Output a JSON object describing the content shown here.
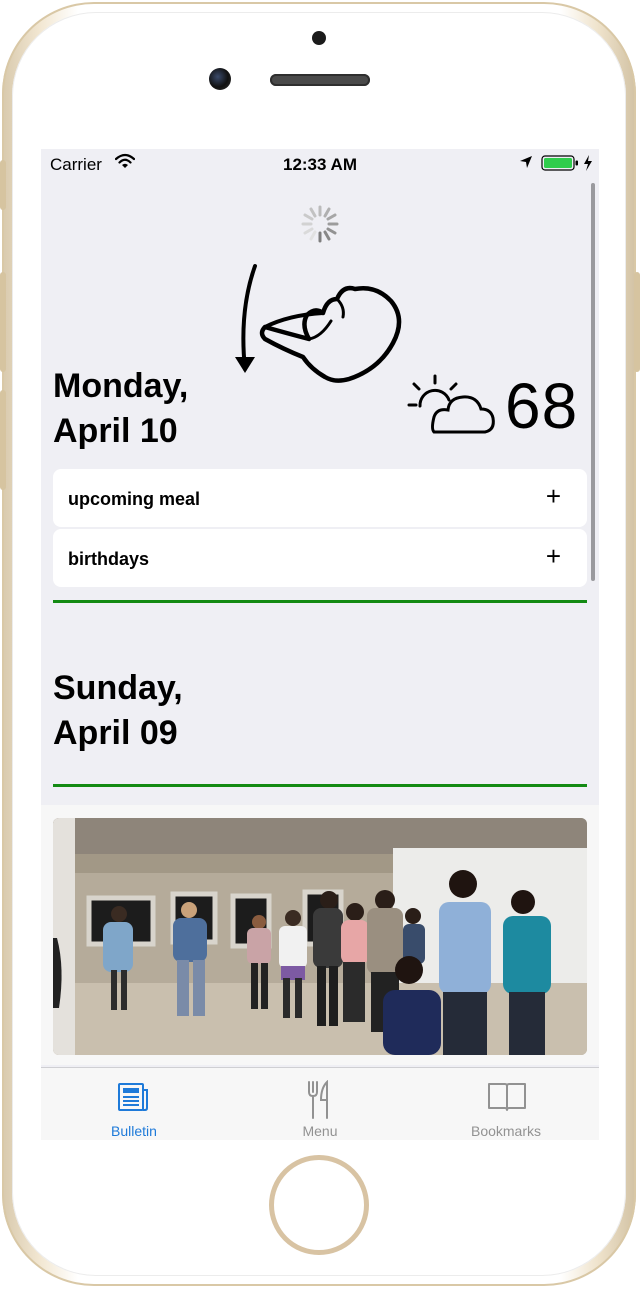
{
  "status_bar": {
    "carrier": "Carrier",
    "time": "12:33 AM"
  },
  "today": {
    "day": "Monday,",
    "date": "April 10",
    "temperature": "68",
    "weather_icon": "partly-sunny-icon"
  },
  "cards": [
    {
      "label": "upcoming meal",
      "action": "+"
    },
    {
      "label": "birthdays",
      "action": "+"
    }
  ],
  "previous_day": {
    "day": "Sunday,",
    "date": "April 09"
  },
  "tabs": [
    {
      "label": "Bulletin",
      "icon": "newspaper-icon",
      "active": true
    },
    {
      "label": "Menu",
      "icon": "fork-knife-icon",
      "active": false
    },
    {
      "label": "Bookmarks",
      "icon": "book-icon",
      "active": false
    }
  ],
  "colors": {
    "accent": "#1e7ad9",
    "divider": "#138a13",
    "background": "#efeff4",
    "inactive_tab": "#929292"
  }
}
